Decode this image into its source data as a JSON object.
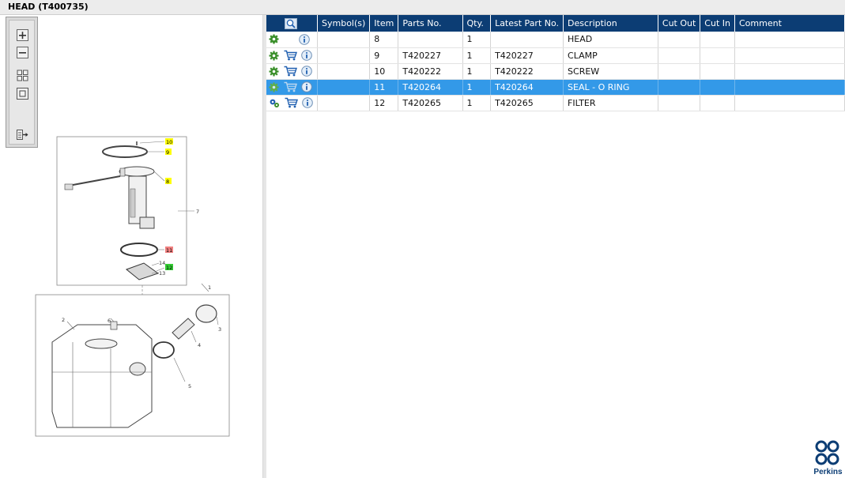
{
  "window": {
    "title": "HEAD (T400735)"
  },
  "toolbox": {
    "buttons": [
      "zoom-in",
      "zoom-out",
      "fit-all",
      "fit-window",
      "export"
    ]
  },
  "diagram": {
    "callouts": {
      "c10": "10",
      "c9": "9",
      "c8": "8",
      "c7": "7",
      "c11": "11",
      "c14": "14",
      "c13": "13",
      "c12": "12",
      "c1": "1",
      "c2": "2",
      "c3": "3",
      "c4": "4",
      "c5": "5",
      "c6": "6"
    }
  },
  "table": {
    "headers": {
      "symbols": "Symbol(s)",
      "item": "Item",
      "parts_no": "Parts No.",
      "qty": "Qty.",
      "latest": "Latest Part No.",
      "description": "Description",
      "cut_out": "Cut Out",
      "cut_in": "Cut In",
      "comment": "Comment"
    },
    "rows": [
      {
        "item": "8",
        "parts_no": "",
        "qty": "1",
        "latest": "",
        "description": "HEAD",
        "cut_out": "",
        "cut_in": "",
        "comment": ""
      },
      {
        "item": "9",
        "parts_no": "T420227",
        "qty": "1",
        "latest": "T420227",
        "description": "CLAMP",
        "cut_out": "",
        "cut_in": "",
        "comment": ""
      },
      {
        "item": "10",
        "parts_no": "T420222",
        "qty": "1",
        "latest": "T420222",
        "description": "SCREW",
        "cut_out": "",
        "cut_in": "",
        "comment": ""
      },
      {
        "item": "11",
        "parts_no": "T420264",
        "qty": "1",
        "latest": "T420264",
        "description": "SEAL - O RING",
        "cut_out": "",
        "cut_in": "",
        "comment": ""
      },
      {
        "item": "12",
        "parts_no": "T420265",
        "qty": "1",
        "latest": "T420265",
        "description": "FILTER",
        "cut_out": "",
        "cut_in": "",
        "comment": ""
      }
    ],
    "selected_item": "11"
  },
  "branding": {
    "logo_text": "Perkins"
  },
  "colors": {
    "header": "#0c3d74",
    "selection": "#3399e8",
    "gear": "#3a8f2a",
    "cart": "#1f5fb0"
  }
}
